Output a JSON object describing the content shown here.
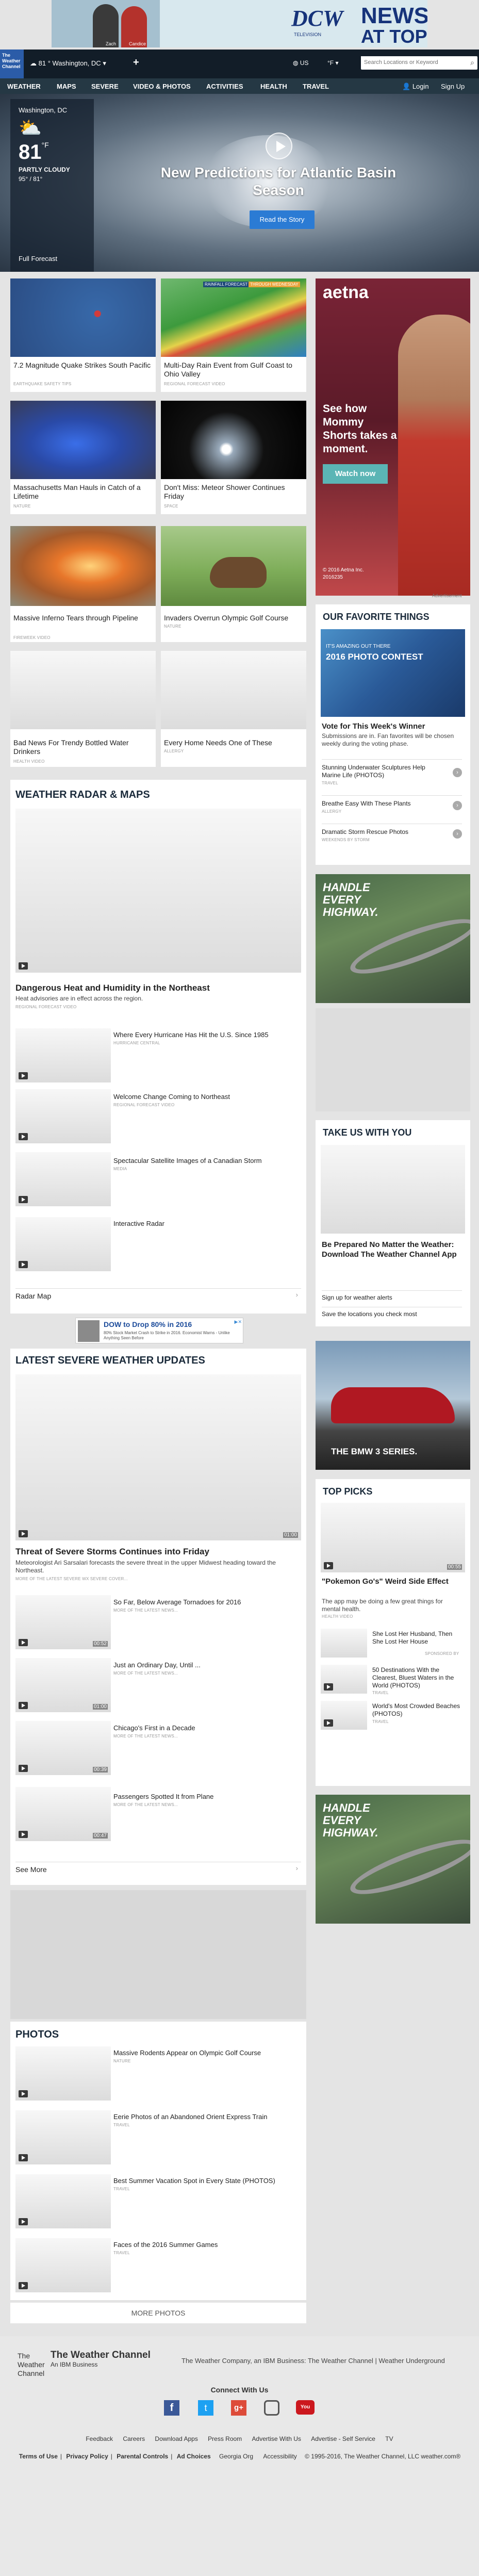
{
  "top_ad": {
    "name1": "Zach",
    "name2": "Candice",
    "brand": "DCW",
    "brand_sub": "TELEVISION",
    "news": "NEWS",
    "at_top": "AT TOP"
  },
  "header": {
    "logo": [
      "The",
      "Weather",
      "Channel"
    ],
    "location": "81 ° Washington, DC",
    "plus": "+",
    "country": "US",
    "unit": "°F",
    "search_placeholder": "Search Locations or Keyword",
    "login": "Login",
    "signup": "Sign Up"
  },
  "nav": [
    "WEATHER",
    "MAPS",
    "SEVERE",
    "VIDEO & PHOTOS",
    "ACTIVITIES",
    "HEALTH",
    "TRAVEL"
  ],
  "now": {
    "city": "Washington, DC",
    "temp": "81",
    "unit": "°F",
    "cond": "PARTLY CLOUDY",
    "range": "95° / 81°",
    "forecast": "Full Forecast"
  },
  "hero": {
    "title": "New Predictions for Atlantic Basin Season",
    "button": "Read the Story"
  },
  "tiles": [
    {
      "title": "7.2 Magnitude Quake Strikes South Pacific",
      "sub": "EARTHQUAKE SAFETY TIPS"
    },
    {
      "title": "Multi-Day Rain Event from Gulf Coast to Ohio Valley",
      "sub": "REGIONAL FORECAST VIDEO",
      "badge1": "RAINFALL FORECAST",
      "badge2": "THROUGH WEDNESDAY"
    },
    {
      "title": "Massachusetts Man Hauls in Catch of a Lifetime",
      "sub": "NATURE"
    },
    {
      "title": "Don't Miss: Meteor Shower Continues Friday",
      "sub": "SPACE"
    },
    {
      "title": "Massive Inferno Tears through Pipeline",
      "sub": "FIREWEEK VIDEO"
    },
    {
      "title": "Invaders Overrun Olympic Golf Course",
      "sub": "NATURE"
    },
    {
      "title": "Bad News For Trendy Bottled Water Drinkers",
      "sub": "HEALTH VIDEO"
    },
    {
      "title": "Every Home Needs One of These",
      "sub": "ALLERGY"
    }
  ],
  "aetna": {
    "brand": "aetna",
    "text": "See how Mommy Shorts takes a moment.",
    "button": "Watch now",
    "copyright": "© 2016 Aetna Inc.",
    "code": "2016235",
    "label": "Advertisement"
  },
  "favorites": {
    "heading": "OUR FAVORITE THINGS",
    "banner1": "IT'S AMAZING OUT THERE",
    "banner2": "2016 PHOTO CONTEST",
    "vote_title": "Vote for This Week's Winner",
    "vote_desc": "Submissions are in. Fan favorites will be chosen weekly during the voting phase.",
    "items": [
      {
        "title": "Stunning Underwater Sculptures Help Marine Life (PHOTOS)",
        "sub": "TRAVEL"
      },
      {
        "title": "Breathe Easy With These Plants",
        "sub": "ALLERGY"
      },
      {
        "title": "Dramatic Storm Rescue Photos",
        "sub": "WEEKENDS BY STORM"
      }
    ]
  },
  "handle": {
    "text": "HANDLE EVERY HIGHWAY."
  },
  "radar": {
    "heading": "WEATHER RADAR & MAPS",
    "lead_title": "Dangerous Heat and Humidity in the Northeast",
    "lead_desc": "Heat advisories are in effect across the region.",
    "lead_sub": "REGIONAL FORECAST VIDEO",
    "items": [
      {
        "title": "Where Every Hurricane Has Hit the U.S. Since 1985",
        "sub": "HURRICANE CENTRAL"
      },
      {
        "title": "Welcome Change Coming to Northeast",
        "sub": "REGIONAL FORECAST VIDEO"
      },
      {
        "title": "Spectacular Satellite Images of a Canadian Storm",
        "sub": "MEDIA"
      },
      {
        "title": "Interactive Radar",
        "sub": ""
      }
    ],
    "more": "Radar Map"
  },
  "app": {
    "heading": "TAKE US WITH YOU",
    "title": "Be Prepared No Matter the Weather: Download The Weather Channel App",
    "link1": "Sign up for weather alerts",
    "link2": "Save the locations you check most"
  },
  "dow_ad": {
    "text1": "DOW to Drop 80% in 2016",
    "text2": "80% Stock Market Crash to Strike in 2016. Economist Warns - Unlike Anything Seen Before"
  },
  "bmw": {
    "text": "THE BMW 3 SERIES."
  },
  "severe": {
    "heading": "LATEST SEVERE WEATHER UPDATES",
    "dur": "01:00",
    "lead_title": "Threat of Severe Storms Continues into Friday",
    "lead_desc": "Meteorologist Ari Sarsalari forecasts the severe threat in the upper Midwest heading toward the Northeast.",
    "lead_sub": "MORE OF THE LATEST SEVERE WX SEVERE COVER...",
    "items": [
      {
        "title": "So Far, Below Average Tornadoes for 2016",
        "sub": "MORE OF THE LATEST NEWS...",
        "dur": "00:52"
      },
      {
        "title": "Just an Ordinary Day, Until ...",
        "sub": "MORE OF THE LATEST NEWS...",
        "dur": "01:00"
      },
      {
        "title": "Chicago's First in a Decade",
        "sub": "MORE OF THE LATEST NEWS...",
        "dur": "00:39"
      },
      {
        "title": "Passengers Spotted It from Plane",
        "sub": "MORE OF THE LATEST NEWS...",
        "dur": "00:47"
      }
    ],
    "more": "See More"
  },
  "picks": {
    "heading": "TOP PICKS",
    "dur": "00:55",
    "lead_title": "\"Pokemon Go's\" Weird Side Effect",
    "lead_desc": "The app may be doing a few great things for mental health.",
    "lead_sub": "HEALTH VIDEO",
    "items": [
      {
        "title": "She Lost Her Husband, Then She Lost Her House",
        "sub": "SPONSORED BY"
      },
      {
        "title": "50 Destinations With the Clearest, Bluest Waters in the World (PHOTOS)",
        "sub": "TRAVEL"
      },
      {
        "title": "World's Most Crowded Beaches (PHOTOS)",
        "sub": "TRAVEL"
      }
    ]
  },
  "photos": {
    "heading": "PHOTOS",
    "items": [
      {
        "title": "Massive Rodents Appear on Olympic Golf Course",
        "sub": "NATURE"
      },
      {
        "title": "Eerie Photos of an Abandoned Orient Express Train",
        "sub": "TRAVEL"
      },
      {
        "title": "Best Summer Vacation Spot in Every State (PHOTOS)",
        "sub": "TRAVEL"
      },
      {
        "title": "Faces of the 2016 Summer Games",
        "sub": "TRAVEL"
      }
    ],
    "more": "MORE PHOTOS"
  },
  "footer": {
    "brand": "The Weather Channel",
    "brand_sub": "An IBM Business",
    "logo": [
      "The",
      "Weather",
      "Channel"
    ],
    "company": "The Weather Company, an IBM Business: The Weather Channel | Weather Underground",
    "connect": "Connect With Us",
    "links1": [
      "Feedback",
      "Careers",
      "Download Apps",
      "Press Room",
      "Advertise With Us",
      "Advertise - Self Service",
      "TV"
    ],
    "links2": [
      "Terms of Use",
      "Privacy Policy",
      "Parental Controls",
      "Ad Choices",
      "Georgia Org",
      "Accessibility"
    ],
    "copy": "© 1995-2016, The Weather Channel, LLC weather.com®",
    "colors": {
      "nav": "#253844",
      "accent": "#2b6cc4",
      "footer": "#e8e8e8"
    }
  }
}
